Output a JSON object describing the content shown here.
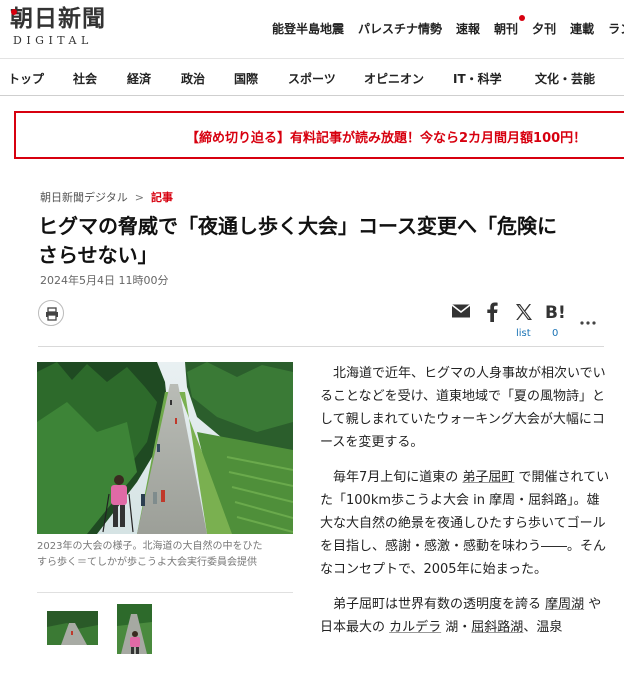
{
  "header": {
    "logo_jp": "朝日新聞",
    "logo_en": "DIGITAL",
    "links": [
      {
        "label": "能登半島地震"
      },
      {
        "label": "パレスチナ情勢"
      },
      {
        "label": "速報"
      },
      {
        "label": "朝刊"
      },
      {
        "label": "夕刊"
      },
      {
        "label": "連載"
      },
      {
        "label": "ランキ"
      }
    ]
  },
  "nav": {
    "items": [
      {
        "label": "トップ"
      },
      {
        "label": "社会"
      },
      {
        "label": "経済"
      },
      {
        "label": "政治"
      },
      {
        "label": "国際"
      },
      {
        "label": "スポーツ"
      },
      {
        "label": "オピニオン"
      },
      {
        "label": "IT・科学"
      },
      {
        "label": "文化・芸能"
      }
    ]
  },
  "promo": {
    "text": "【締め切り迫る】有料記事が読み放題！今なら2カ月間月額100円！"
  },
  "breadcrumb": {
    "site": "朝日新聞デジタル",
    "separator": ">",
    "category": "記事"
  },
  "article": {
    "headline_line1": "ヒグマの脅威で「夜通し歩く大会」コース変更へ「危険に",
    "headline_line2": "さらせない」",
    "date": "2024年5月4日 11時00分",
    "caption_line1": "2023年の大会の様子。北海道の大自然の中をひた",
    "caption_line2": "すら歩く＝てしかが歩こうよ大会実行委員会提供",
    "p1": "北海道で近年、ヒグマの人身事故が相次いでいることなどを受け、道東地域で「夏の風物詩」として親しまれていたウォーキング大会が大幅にコースを変更する。",
    "p2_a": "毎年7月上旬に道東の ",
    "p2_link": "弟子屈町",
    "p2_b": " で開催されていた「100km歩こうよ大会 in 摩周・屈斜路」。雄大な大自然の絶景を夜通しひたすら歩いてゴールを目指し、感謝・感激・感動を味わう――。そんなコンセプトで、2005年に始まった。",
    "p3_a": "弟子屈町は世界有数の透明度を誇る ",
    "p3_link1": "摩周湖",
    "p3_b": " や日本最大の ",
    "p3_link2": "カルデラ",
    "p3_c": " 湖・",
    "p3_link3": "屈斜路湖",
    "p3_d": "、温泉"
  },
  "share": {
    "list_label": "list",
    "hatena_count": "0"
  },
  "icons": {
    "print": "print-icon",
    "mail": "mail-icon",
    "facebook": "facebook-icon",
    "x": "x-icon",
    "hatena": "hatena-bookmark-icon",
    "more": "more-icon"
  },
  "colors": {
    "brand_red": "#d7000f",
    "link_blue": "#1a73b5"
  }
}
